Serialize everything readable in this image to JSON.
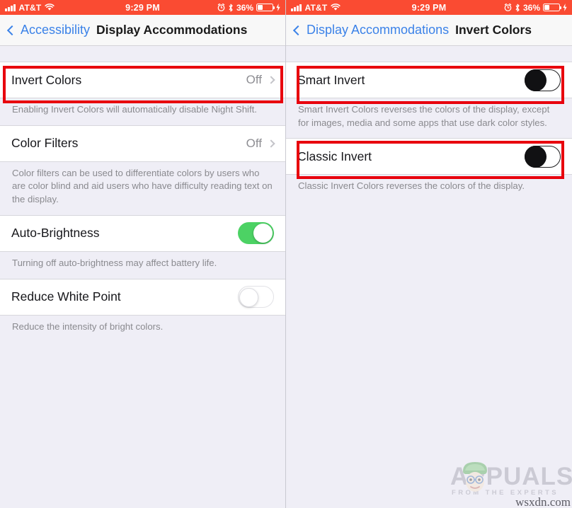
{
  "status_bar": {
    "carrier": "AT&T",
    "time": "9:29 PM",
    "battery_percent": "36%",
    "icons": [
      "signal-bars-icon",
      "wifi-icon",
      "alarm-clock-icon",
      "bluetooth-icon",
      "battery-icon",
      "charging-bolt-icon"
    ],
    "background_color": "#fa4b32"
  },
  "left_screen": {
    "nav": {
      "back_label": "Accessibility",
      "title": "Display Accommodations"
    },
    "rows": [
      {
        "label": "Invert Colors",
        "value": "Off",
        "type": "disclosure",
        "highlighted": true,
        "footnote": "Enabling Invert Colors will automatically disable Night Shift."
      },
      {
        "label": "Color Filters",
        "value": "Off",
        "type": "disclosure",
        "highlighted": false,
        "footnote": "Color filters can be used to differentiate colors by users who are color blind and aid users who have difficulty reading text on the display."
      },
      {
        "label": "Auto-Brightness",
        "value": "On",
        "type": "switch",
        "switch_state": "on",
        "highlighted": false,
        "footnote": "Turning off auto-brightness may affect battery life."
      },
      {
        "label": "Reduce White Point",
        "value": "Off",
        "type": "switch",
        "switch_state": "off",
        "highlighted": false,
        "footnote": "Reduce the intensity of bright colors."
      }
    ]
  },
  "right_screen": {
    "nav": {
      "back_label": "Display Accommodations",
      "title": "Invert Colors"
    },
    "rows": [
      {
        "label": "Smart Invert",
        "value": "Off",
        "type": "switch",
        "switch_state": "off",
        "highlighted": true,
        "footnote": "Smart Invert Colors reverses the colors of the display, except for images, media and some apps that use dark color styles."
      },
      {
        "label": "Classic Invert",
        "value": "Off",
        "type": "switch",
        "switch_state": "off",
        "highlighted": true,
        "footnote": "Classic Invert Colors reverses the colors of the display."
      }
    ]
  },
  "watermark": {
    "brand": "APPUALS",
    "tagline": "FROM THE EXPERTS",
    "domain": "wsxdn.com"
  },
  "colors": {
    "status_bar_red": "#fa4b32",
    "highlight_red": "#e8000d",
    "ios_blue": "#3b82e8",
    "switch_green": "#4cd264",
    "page_background": "#efeef6"
  }
}
